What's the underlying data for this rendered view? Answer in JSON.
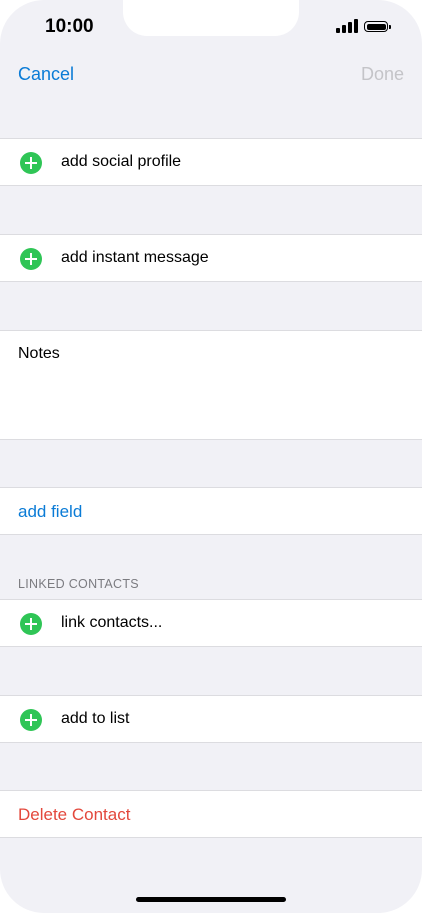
{
  "status_bar": {
    "time": "10:00"
  },
  "nav": {
    "cancel_label": "Cancel",
    "done_label": "Done"
  },
  "rows": {
    "social_profile": "add social profile",
    "instant_message": "add instant message",
    "notes": "Notes",
    "add_field": "add field",
    "linked_contacts_header": "LINKED CONTACTS",
    "link_contacts": "link contacts...",
    "add_to_list": "add to list",
    "delete_contact": "Delete Contact"
  },
  "colors": {
    "accent": "#0a7bd6",
    "destructive": "#e3483c",
    "add_green": "#2fc556",
    "disabled": "#c4c4c8"
  }
}
